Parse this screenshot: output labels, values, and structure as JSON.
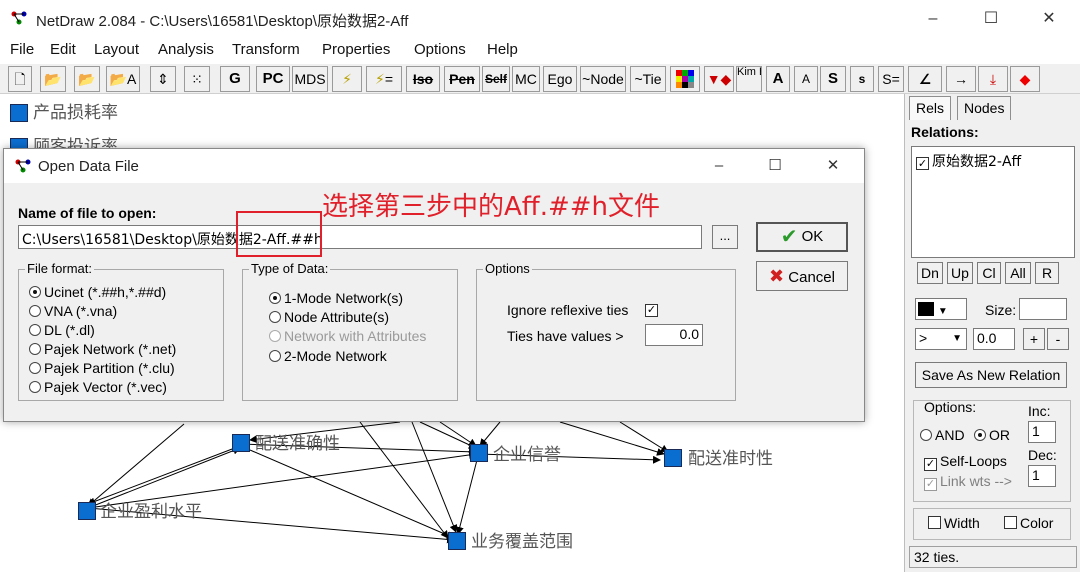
{
  "window": {
    "title": "NetDraw 2.084 - C:\\Users\\16581\\Desktop\\原始数据2-Aff",
    "minimize": "–",
    "maximize": "☐",
    "close": "✕"
  },
  "menu": [
    "File",
    "Edit",
    "Layout",
    "Analysis",
    "Transform",
    "Properties",
    "Options",
    "Help"
  ],
  "toolbar": {
    "g": "G",
    "pc": "PC",
    "mds": "MDS",
    "eq": "=",
    "iso": "Iso",
    "pen": "Pen",
    "self": "Self",
    "mc": "MC",
    "ego": "Ego",
    "node": "~Node",
    "tie": "~Tie",
    "kimbill": "Kim Bill",
    "a_big": "A",
    "a_small": "A",
    "s_big": "S",
    "s_small": "s",
    "s_eq": "S=",
    "arrow": "→",
    "dot": "◆"
  },
  "network": {
    "nodes": [
      {
        "label": "产品损耗率"
      },
      {
        "label": "顾客投诉率"
      },
      {
        "label": "配送准确性"
      },
      {
        "label": "企业信誉"
      },
      {
        "label": "配送准时性"
      },
      {
        "label": "企业盈利水平"
      },
      {
        "label": "业务覆盖范围"
      }
    ]
  },
  "right_panel": {
    "tabs": [
      "Rels",
      "Nodes"
    ],
    "relations_label": "Relations:",
    "relations": [
      {
        "name": "原始数据2-Aff",
        "checked": true
      }
    ],
    "buttons": [
      "Dn",
      "Up",
      "Cl",
      "All",
      "R"
    ],
    "size_label": "Size:",
    "size_value": "",
    "operator": ">",
    "threshold": "0.0",
    "plus": "+",
    "minus": "-",
    "save_relation": "Save As New Relation",
    "options_label": "Options:",
    "inc_label": "Inc:",
    "inc_value": "1",
    "and_label": "AND",
    "or_label": "OR",
    "self_loops": "Self-Loops",
    "link_wts": "Link wts -->",
    "dec_label": "Dec:",
    "dec_value": "1",
    "width_label": "Width",
    "color_label": "Color",
    "status": "32 ties."
  },
  "dialog": {
    "title": "Open Data File",
    "filename_label": "Name of file to open:",
    "filename_value": "C:\\Users\\16581\\Desktop\\原始数据2-Aff.##h",
    "browse": "...",
    "ok": "OK",
    "cancel": "Cancel",
    "file_format": {
      "title": "File format:",
      "options": [
        "Ucinet (*.##h,*.##d)",
        "VNA (*.vna)",
        "DL (*.dl)",
        "Pajek Network (*.net)",
        "Pajek Partition (*.clu)",
        "Pajek Vector (*.vec)"
      ],
      "selected": 0
    },
    "type_of_data": {
      "title": "Type of Data:",
      "options": [
        "1-Mode Network(s)",
        "Node Attribute(s)",
        "Network with Attributes",
        "2-Mode Network"
      ],
      "selected": 0
    },
    "options": {
      "title": "Options",
      "ignore_reflexive": "Ignore reflexive ties",
      "ignore_checked": true,
      "ties_have_values": "Ties have values >",
      "ties_value": "0.0"
    },
    "annotation": "选择第三步中的Aff.##h文件"
  }
}
